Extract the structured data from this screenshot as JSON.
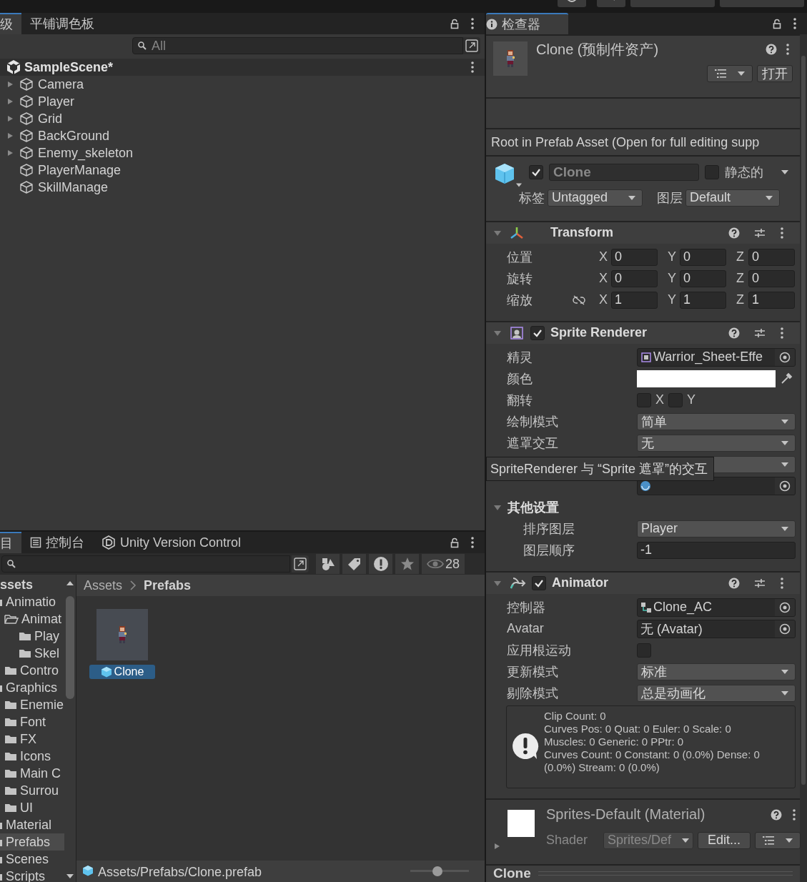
{
  "toolbar": {
    "buttons": [
      {
        "kind": "history"
      },
      {
        "kind": "search"
      },
      {
        "kind": "dropdown"
      },
      {
        "kind": "dropdown"
      }
    ]
  },
  "hierarchy": {
    "tabs": [
      {
        "label": "级",
        "selected": true
      },
      {
        "label": "平铺调色板",
        "selected": false
      }
    ],
    "search": {
      "placeholder": "All"
    },
    "scene": "SampleScene*",
    "items": [
      {
        "label": "Camera",
        "expandable": true
      },
      {
        "label": "Player",
        "expandable": true
      },
      {
        "label": "Grid",
        "expandable": true
      },
      {
        "label": "BackGround",
        "expandable": true
      },
      {
        "label": "Enemy_skeleton",
        "expandable": true
      },
      {
        "label": "PlayerManage",
        "expandable": false
      },
      {
        "label": "SkillManage",
        "expandable": false
      }
    ]
  },
  "project": {
    "tabs": [
      {
        "label": "目",
        "kind": "plain",
        "selected": true
      },
      {
        "label": "控制台",
        "kind": "console",
        "selected": false
      },
      {
        "label": "Unity Version Control",
        "kind": "vcs",
        "selected": false
      }
    ],
    "hidden_count": "28",
    "root": "ssets",
    "folders": [
      {
        "label": "Animatio",
        "selected": false,
        "children": [
          {
            "label": "Animat",
            "selected": false,
            "expanded": true,
            "children": [
              {
                "label": "Play",
                "selected": false
              },
              {
                "label": "Skel",
                "selected": false
              }
            ]
          },
          {
            "label": "Contro",
            "selected": false
          }
        ]
      },
      {
        "label": "Graphics",
        "selected": false,
        "children": [
          {
            "label": "Enemie",
            "selected": false
          },
          {
            "label": "Font",
            "selected": false
          },
          {
            "label": "FX",
            "selected": false
          },
          {
            "label": "Icons",
            "selected": false
          },
          {
            "label": "Main C",
            "selected": false
          },
          {
            "label": "Surrou",
            "selected": false
          },
          {
            "label": "UI",
            "selected": false
          }
        ]
      },
      {
        "label": "Material",
        "selected": false
      },
      {
        "label": "Prefabs",
        "selected": true
      },
      {
        "label": "Scenes",
        "selected": false
      },
      {
        "label": "Scripts",
        "selected": false
      }
    ],
    "breadcrumb": [
      "Assets",
      "Prefabs"
    ],
    "assets": [
      {
        "label": "Clone",
        "selected": true
      }
    ],
    "status": "Assets/Prefabs/Clone.prefab",
    "zoom": {
      "level": 0.45
    }
  },
  "inspector": {
    "tab": "检查器",
    "title": "Clone (预制件资产)",
    "open_button": "打开",
    "notice": "Root in Prefab Asset (Open for full editing supp",
    "object": {
      "active": true,
      "name": "Clone",
      "static": false,
      "static_label": "静态的",
      "tag_label": "标签",
      "tag": "Untagged",
      "layer_label": "图层",
      "layer": "Default"
    },
    "components": [
      {
        "kind": "transform",
        "title": "Transform",
        "rows": [
          {
            "label": "位置",
            "linked": false,
            "values": [
              {
                "axis": "X",
                "value": "0"
              },
              {
                "axis": "Y",
                "value": "0"
              },
              {
                "axis": "Z",
                "value": "0"
              }
            ]
          },
          {
            "label": "旋转",
            "linked": false,
            "values": [
              {
                "axis": "X",
                "value": "0"
              },
              {
                "axis": "Y",
                "value": "0"
              },
              {
                "axis": "Z",
                "value": "0"
              }
            ]
          },
          {
            "label": "缩放",
            "linked": true,
            "values": [
              {
                "axis": "X",
                "value": "1"
              },
              {
                "axis": "Y",
                "value": "1"
              },
              {
                "axis": "Z",
                "value": "1"
              }
            ]
          }
        ]
      },
      {
        "kind": "sprite_renderer",
        "title": "Sprite Renderer",
        "enabled": true,
        "tooltip": "SpriteRenderer 与 “Sprite 遮罩”的交互",
        "rows": [
          {
            "kind": "sprite_field",
            "label": "精灵",
            "value": "Warrior_Sheet-Effe"
          },
          {
            "kind": "color",
            "label": "颜色",
            "color": "#ffffff"
          },
          {
            "kind": "flip",
            "label": "翻转",
            "options": [
              {
                "label": "X",
                "checked": false
              },
              {
                "label": "Y",
                "checked": false
              }
            ]
          },
          {
            "kind": "dropdown",
            "label": "绘制模式",
            "value": "简单"
          },
          {
            "kind": "dropdown",
            "label": "遮罩交互",
            "value": "无"
          },
          {
            "kind": "dropdown",
            "covered": true
          },
          {
            "kind": "material_field"
          },
          {
            "kind": "foldout",
            "label": "其他设置",
            "expanded": true,
            "children": [
              {
                "kind": "dropdown",
                "label": "排序图层",
                "value": "Player"
              },
              {
                "kind": "number",
                "label": "图层顺序",
                "value": "-1"
              }
            ]
          }
        ]
      },
      {
        "kind": "animator",
        "title": "Animator",
        "enabled": true,
        "rows": [
          {
            "kind": "controller_field",
            "label": "控制器",
            "value": "Clone_AC"
          },
          {
            "kind": "object_field",
            "label": "Avatar",
            "value": "无 (Avatar)"
          },
          {
            "kind": "checkbox",
            "label": "应用根运动",
            "checked": false
          },
          {
            "kind": "dropdown",
            "label": "更新模式",
            "value": "标准"
          },
          {
            "kind": "dropdown",
            "label": "剔除模式",
            "value": "总是动画化"
          }
        ],
        "info": "Clip Count: 0\nCurves Pos: 0 Quat: 0 Euler: 0 Scale: 0\nMuscles: 0 Generic: 0 PPtr: 0\nCurves Count: 0 Constant: 0 (0.0%) Dense: 0 (0.0%) Stream: 0 (0.0%)"
      }
    ],
    "material": {
      "title": "Sprites-Default (Material)",
      "shader_label": "Shader",
      "shader": "Sprites/Def",
      "edit_button": "Edit..."
    },
    "footer": "Clone"
  }
}
